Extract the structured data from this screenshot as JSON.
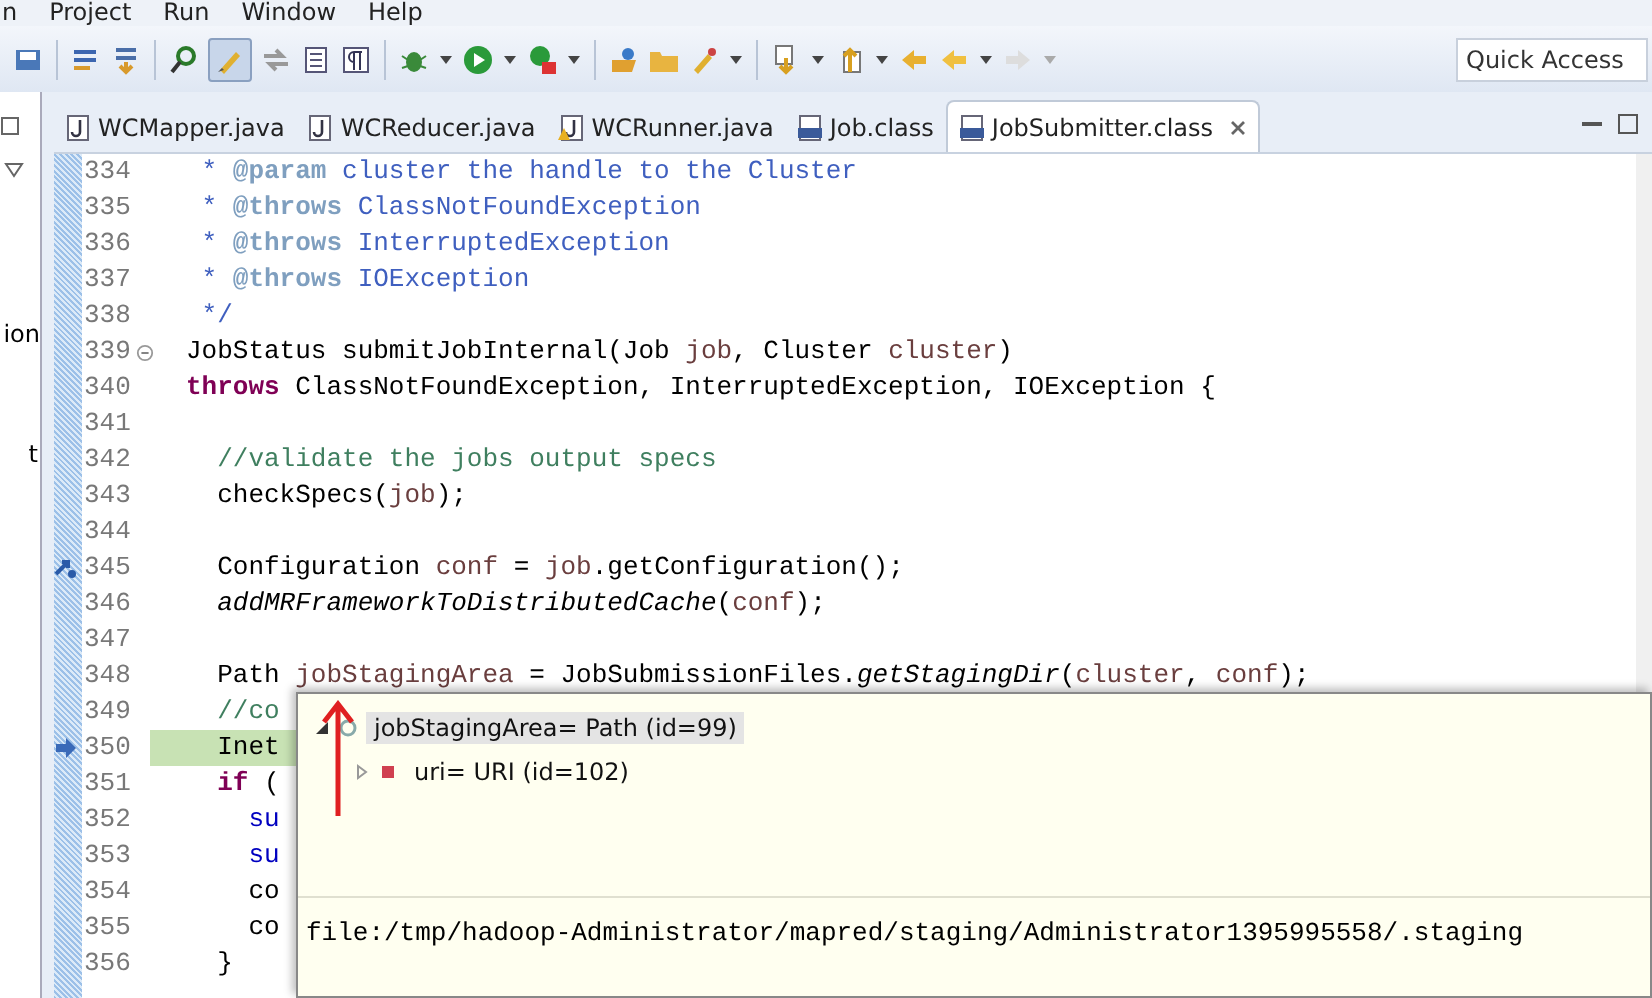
{
  "menu": [
    "n",
    "Project",
    "Run",
    "Window",
    "Help"
  ],
  "toolbar": {
    "highlight_toggle": {
      "on": true
    },
    "quick_access": {
      "placeholder": "Quick Access"
    }
  },
  "tabs": [
    {
      "label": "WCMapper.java",
      "kind": "java",
      "selected": false
    },
    {
      "label": "WCReducer.java",
      "kind": "java",
      "selected": false
    },
    {
      "label": "WCRunner.java",
      "kind": "java",
      "warning": true,
      "selected": false
    },
    {
      "label": "Job.class",
      "kind": "class",
      "selected": false
    },
    {
      "label": "JobSubmitter.class",
      "kind": "class",
      "selected": true
    }
  ],
  "side_panel": {
    "texts": [
      "ion",
      "t"
    ]
  },
  "editor": {
    "lines": [
      {
        "number": "334",
        "foldable": false,
        "current": false,
        "segments": [
          {
            "text": " * ",
            "kind": "doc"
          },
          {
            "text": "@param",
            "kind": "doctag"
          },
          {
            "text": " cluster the handle to the Cluster",
            "kind": "doc"
          }
        ]
      },
      {
        "number": "335",
        "foldable": false,
        "current": false,
        "segments": [
          {
            "text": " * ",
            "kind": "doc"
          },
          {
            "text": "@throws",
            "kind": "doctag"
          },
          {
            "text": " ClassNotFoundException",
            "kind": "doc"
          }
        ]
      },
      {
        "number": "336",
        "foldable": false,
        "current": false,
        "segments": [
          {
            "text": " * ",
            "kind": "doc"
          },
          {
            "text": "@throws",
            "kind": "doctag"
          },
          {
            "text": " InterruptedException",
            "kind": "doc"
          }
        ]
      },
      {
        "number": "337",
        "foldable": false,
        "current": false,
        "segments": [
          {
            "text": " * ",
            "kind": "doc"
          },
          {
            "text": "@throws",
            "kind": "doctag"
          },
          {
            "text": " IOException",
            "kind": "doc"
          }
        ]
      },
      {
        "number": "338",
        "foldable": false,
        "current": false,
        "segments": [
          {
            "text": " */",
            "kind": "doc"
          }
        ]
      },
      {
        "number": "339",
        "foldable": true,
        "current": false,
        "segments": [
          {
            "text": "JobStatus submitJobInternal(Job ",
            "kind": "plain"
          },
          {
            "text": "job",
            "kind": "var"
          },
          {
            "text": ", Cluster ",
            "kind": "plain"
          },
          {
            "text": "cluster",
            "kind": "var"
          },
          {
            "text": ")",
            "kind": "plain"
          }
        ]
      },
      {
        "number": "340",
        "foldable": false,
        "current": false,
        "segments": [
          {
            "text": "throws",
            "kind": "keyword"
          },
          {
            "text": " ClassNotFoundException, InterruptedException, IOException {",
            "kind": "plain"
          }
        ]
      },
      {
        "number": "341",
        "foldable": false
      },
      {
        "number": "342",
        "foldable": false,
        "current": false,
        "segments": [
          {
            "text": "  //validate the jobs output specs",
            "kind": "comment"
          }
        ]
      },
      {
        "number": "343",
        "foldable": false,
        "current": false,
        "segments": [
          {
            "text": "  checkSpecs(",
            "kind": "plain"
          },
          {
            "text": "job",
            "kind": "var"
          },
          {
            "text": ");",
            "kind": "plain"
          }
        ]
      },
      {
        "number": "344",
        "foldable": false
      },
      {
        "number": "345",
        "marker": {
          "kind": "step"
        },
        "foldable": false,
        "current": false,
        "segments": [
          {
            "text": "  Configuration ",
            "kind": "plain"
          },
          {
            "text": "conf",
            "kind": "var"
          },
          {
            "text": " = ",
            "kind": "plain"
          },
          {
            "text": "job",
            "kind": "var"
          },
          {
            "text": ".getConfiguration();",
            "kind": "plain"
          }
        ]
      },
      {
        "number": "346",
        "foldable": false,
        "current": false,
        "segments": [
          {
            "text": "  addMRFrameworkToDistributedCache",
            "kind": "static"
          },
          {
            "text": "(",
            "kind": "plain"
          },
          {
            "text": "conf",
            "kind": "var"
          },
          {
            "text": ");",
            "kind": "plain"
          }
        ]
      },
      {
        "number": "347",
        "foldable": false
      },
      {
        "number": "348",
        "foldable": false,
        "current": false,
        "segments": [
          {
            "text": "  Path ",
            "kind": "plain"
          },
          {
            "text": "jobStagingArea",
            "kind": "var"
          },
          {
            "text": " = JobSubmissionFiles.",
            "kind": "plain"
          },
          {
            "text": "getStagingDir",
            "kind": "static"
          },
          {
            "text": "(",
            "kind": "plain"
          },
          {
            "text": "cluster",
            "kind": "var"
          },
          {
            "text": ", ",
            "kind": "plain"
          },
          {
            "text": "conf",
            "kind": "var"
          },
          {
            "text": ");",
            "kind": "plain"
          }
        ]
      },
      {
        "number": "349",
        "foldable": false,
        "current": false,
        "segments": [
          {
            "text": "  //co",
            "kind": "comment"
          }
        ]
      },
      {
        "number": "350",
        "marker": {
          "kind": "pointer"
        },
        "foldable": false,
        "current": true,
        "segments": [
          {
            "text": "  Inet",
            "kind": "plain"
          }
        ]
      },
      {
        "number": "351",
        "foldable": false,
        "current": false,
        "segments": [
          {
            "text": "  if",
            "kind": "keyword"
          },
          {
            "text": " (",
            "kind": "plain"
          }
        ]
      },
      {
        "number": "352",
        "foldable": false,
        "current": false,
        "segments": [
          {
            "text": "    su",
            "kind": "field"
          }
        ]
      },
      {
        "number": "353",
        "foldable": false,
        "current": false,
        "segments": [
          {
            "text": "    su",
            "kind": "field"
          }
        ]
      },
      {
        "number": "354",
        "foldable": false,
        "current": false,
        "segments": [
          {
            "text": "    co",
            "kind": "plain"
          }
        ]
      },
      {
        "number": "355",
        "foldable": false,
        "current": false,
        "segments": [
          {
            "text": "    co",
            "kind": "plain"
          }
        ]
      },
      {
        "number": "356",
        "foldable": false,
        "current": false,
        "segments": [
          {
            "text": "  }",
            "kind": "plain"
          }
        ]
      }
    ]
  },
  "inspect_popup": {
    "tree": [
      {
        "label": "jobStagingArea= Path  (id=99)",
        "expanded": true,
        "selected": true,
        "children": [
          {
            "label": "uri= URI  (id=102)",
            "expanded": false,
            "selected": false
          }
        ]
      }
    ],
    "detail": "file:/tmp/hadoop-Administrator/mapred/staging/Administrator1395995558/.staging"
  }
}
